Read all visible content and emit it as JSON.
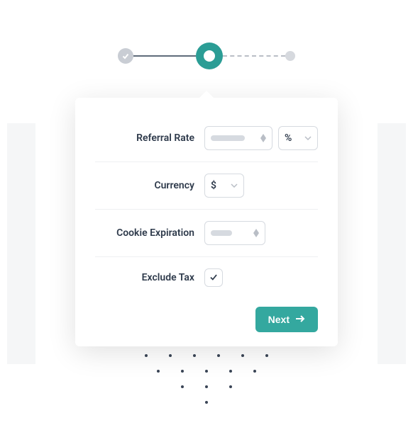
{
  "stepper": {
    "steps": [
      "completed",
      "current",
      "future"
    ]
  },
  "form": {
    "referral_rate": {
      "label": "Referral Rate",
      "value": "",
      "unit": "%"
    },
    "currency": {
      "label": "Currency",
      "value": "$"
    },
    "cookie_expiration": {
      "label": "Cookie Expiration",
      "value": ""
    },
    "exclude_tax": {
      "label": "Exclude Tax",
      "checked": true
    }
  },
  "footer": {
    "next_label": "Next"
  },
  "colors": {
    "accent": "#2b9d95",
    "button": "#34a89f",
    "text": "#2e3a4b",
    "border": "#d6dae0"
  }
}
